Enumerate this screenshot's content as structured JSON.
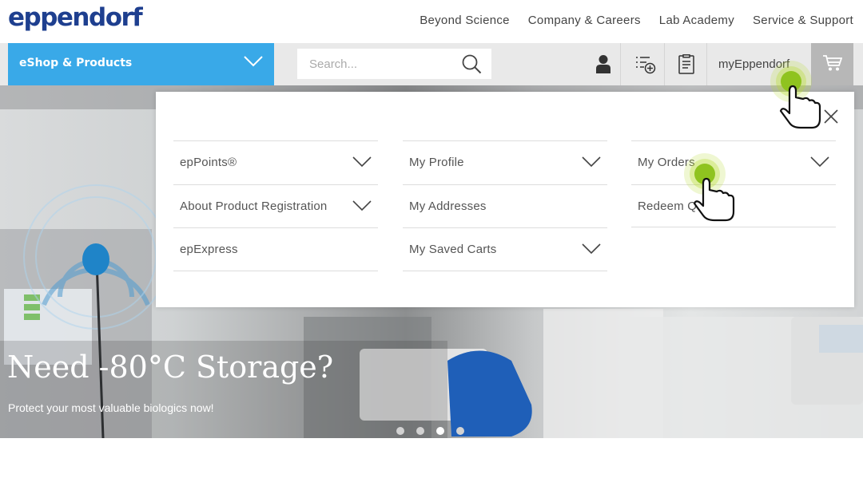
{
  "brand": {
    "logo_text": "eppendorf",
    "color": "#1e3f8f"
  },
  "top_nav": [
    "Beyond Science",
    "Company & Careers",
    "Lab Academy",
    "Service & Support"
  ],
  "nav": {
    "eshop_label": "eShop & Products",
    "search_placeholder": "Search...",
    "my_eppendorf": "myEppendorf",
    "accent": "#39a9e8"
  },
  "dropdown": {
    "columns": [
      [
        {
          "label": "epPoints®",
          "expandable": true
        },
        {
          "label": "About Product Registration",
          "expandable": true
        },
        {
          "label": "epExpress",
          "expandable": false
        }
      ],
      [
        {
          "label": "My Profile",
          "expandable": true
        },
        {
          "label": "My Addresses",
          "expandable": false
        },
        {
          "label": "My Saved Carts",
          "expandable": true
        }
      ],
      [
        {
          "label": "My Orders",
          "expandable": true
        },
        {
          "label": "Redeem Qu",
          "expandable": false
        }
      ]
    ]
  },
  "hero": {
    "headline": "Need -80°C Storage?",
    "subtext": "Protect your most valuable biologics now!",
    "slides": 4,
    "active_slide": 3
  },
  "icons": [
    "search-icon",
    "user-icon",
    "list-add-icon",
    "clipboard-icon",
    "cart-icon",
    "close-icon",
    "chevron-down-icon",
    "hand-pointer-icon"
  ]
}
